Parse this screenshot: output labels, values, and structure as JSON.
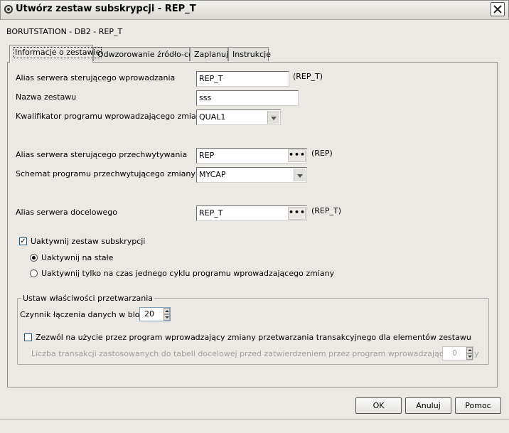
{
  "window": {
    "title": "Utwórz zestaw subskrypcji - REP_T",
    "icon": "gear-icon"
  },
  "subtitle": "BORUTSTATION - DB2 - REP_T",
  "tabs": [
    {
      "label": "Informacje o zestawie"
    },
    {
      "label": "Odwzorowanie źródło-cel"
    },
    {
      "label": "Zaplanuj"
    },
    {
      "label": "Instrukcje"
    }
  ],
  "form": {
    "capture_alias_label": "Alias serwera sterującego wprowadzania",
    "capture_alias_value": "REP_T",
    "capture_alias_note": "(REP_T)",
    "set_name_label": "Nazwa zestawu",
    "set_name_value": "sss",
    "qualifier_label": "Kwalifikator programu wprowadzającego zmiany",
    "qualifier_value": "QUAL1",
    "capture_control_alias_label": "Alias serwera sterującego przechwytywania",
    "capture_control_alias_value": "REP",
    "capture_control_alias_note": "(REP)",
    "capture_schema_label": "Schemat programu przechwytującego zmiany",
    "capture_schema_value": "MYCAP",
    "target_alias_label": "Alias serwera docelowego",
    "target_alias_value": "REP_T",
    "target_alias_note": "(REP_T)",
    "browse_label": "•••",
    "activate_label": "Uaktywnij zestaw subskrypcji",
    "activate_checked": true,
    "radio_permanent_label": "Uaktywnij na stałe",
    "radio_once_label": "Uaktywnij tylko na czas jednego cyklu programu wprowadzającego zmiany",
    "radio_selected": "permanent"
  },
  "processing": {
    "group_title": "Ustaw właściwości przetwarzania",
    "blocking_label": "Czynnik łączenia danych w bloki",
    "blocking_value": "20",
    "transactional_label": "Zezwól na użycie przez program wprowadzający zmiany przetwarzania transakcyjnego dla elementów zestawu",
    "transactional_checked": false,
    "commit_label": "Liczba transakcji zastosowanych do tabeli docelowej przed zatwierdzeniem przez program wprowadzający zmiany",
    "commit_value": "0"
  },
  "buttons": {
    "ok": "OK",
    "cancel": "Anuluj",
    "help": "Pomoc"
  }
}
